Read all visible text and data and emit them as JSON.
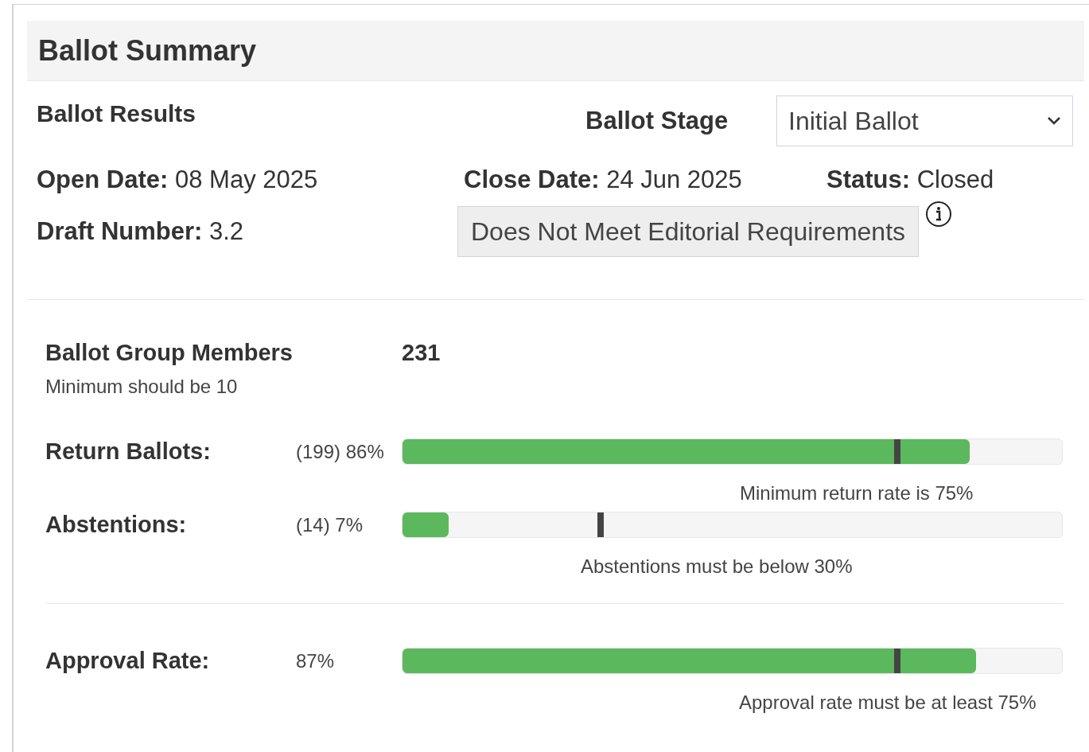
{
  "header": {
    "title": "Ballot Summary"
  },
  "results": {
    "title": "Ballot Results",
    "stage_label": "Ballot Stage",
    "stage_select": {
      "value": "Initial Ballot"
    },
    "fields": [
      {
        "label": "Open Date:",
        "value": "08 May 2025"
      },
      {
        "label": "Close Date:",
        "value": "24 Jun 2025"
      },
      {
        "label": "Status:",
        "value": "Closed"
      },
      {
        "label": "Draft Number:",
        "value": "3.2"
      }
    ],
    "badge": "Does Not Meet Editorial Requirements"
  },
  "members": {
    "label": "Ballot Group Members",
    "count": "231",
    "note": "Minimum should be 10"
  },
  "meters": [
    {
      "label": "Return Ballots:",
      "reading": "(199) 86%",
      "level": 0.86,
      "marker": {
        "level": 0.75
      },
      "caption": "Minimum return rate is 75%"
    },
    {
      "label": "Abstentions:",
      "reading": "(14) 7%",
      "level": 0.07,
      "marker": {
        "level": 0.3
      },
      "caption": "Abstentions must be below 30%"
    },
    {
      "label": "Approval Rate:",
      "reading": "87%",
      "level": 0.87,
      "marker": {
        "level": 0.75
      },
      "caption": "Approval rate must be at least 75%"
    }
  ]
}
